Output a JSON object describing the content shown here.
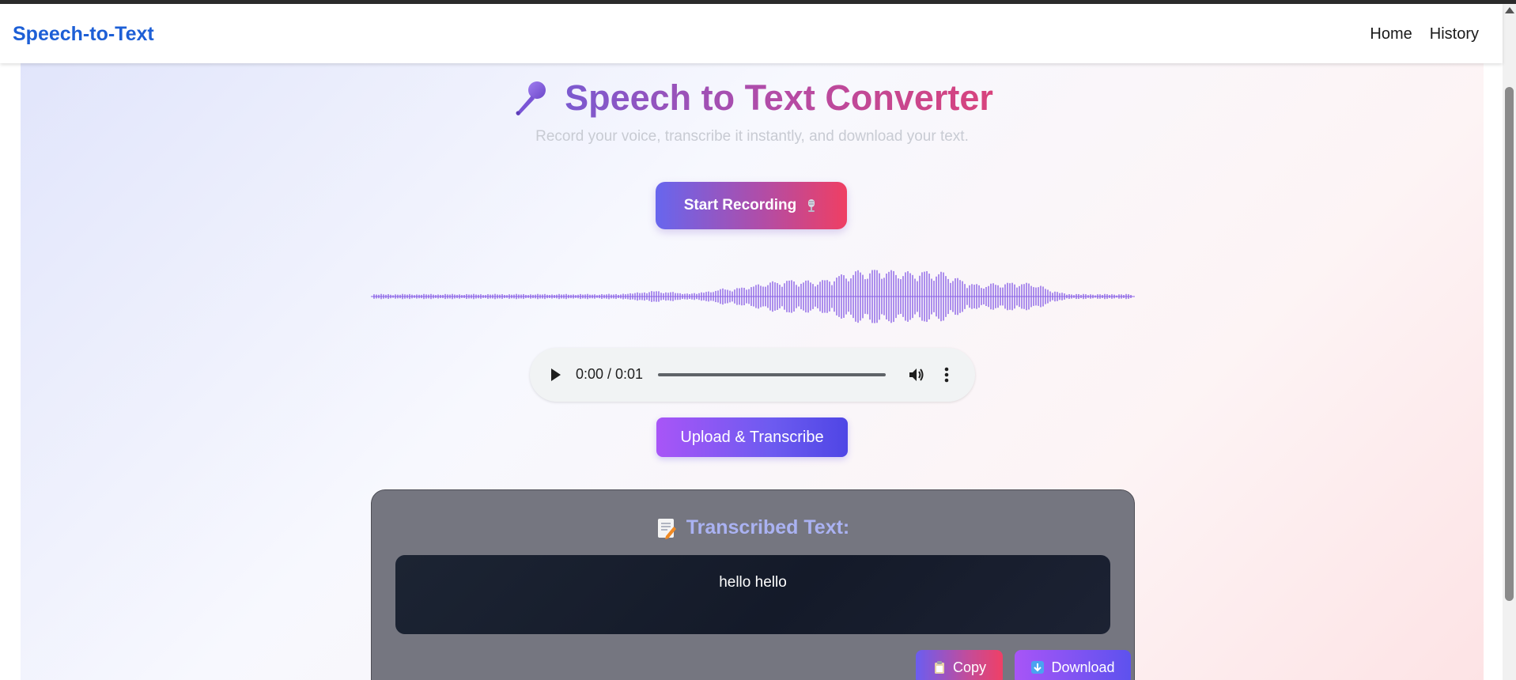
{
  "navbar": {
    "brand": "Speech-to-Text",
    "links": [
      "Home",
      "History"
    ]
  },
  "hero": {
    "title": "Speech to Text Converter",
    "subtitle": "Record your voice, transcribe it instantly, and download your text.",
    "title_icon": "microphone-icon"
  },
  "record_button": {
    "label": "Start Recording",
    "icon": "studio-microphone-icon"
  },
  "audio_player": {
    "time": "0:00 / 0:01",
    "progress": 0
  },
  "upload_button": {
    "label": "Upload & Transcribe"
  },
  "transcript": {
    "heading": "Transcribed Text:",
    "icon": "memo-icon",
    "text": "hello hello"
  },
  "actions": {
    "copy_label": "Copy",
    "copy_icon": "clipboard-icon",
    "download_label": "Download",
    "download_icon": "down-arrow-icon"
  },
  "colors": {
    "brand": "#1d5fd6",
    "accent_purple": "#7b5ad0",
    "accent_pink": "#d8437c",
    "waveform": "#8b62e6"
  }
}
